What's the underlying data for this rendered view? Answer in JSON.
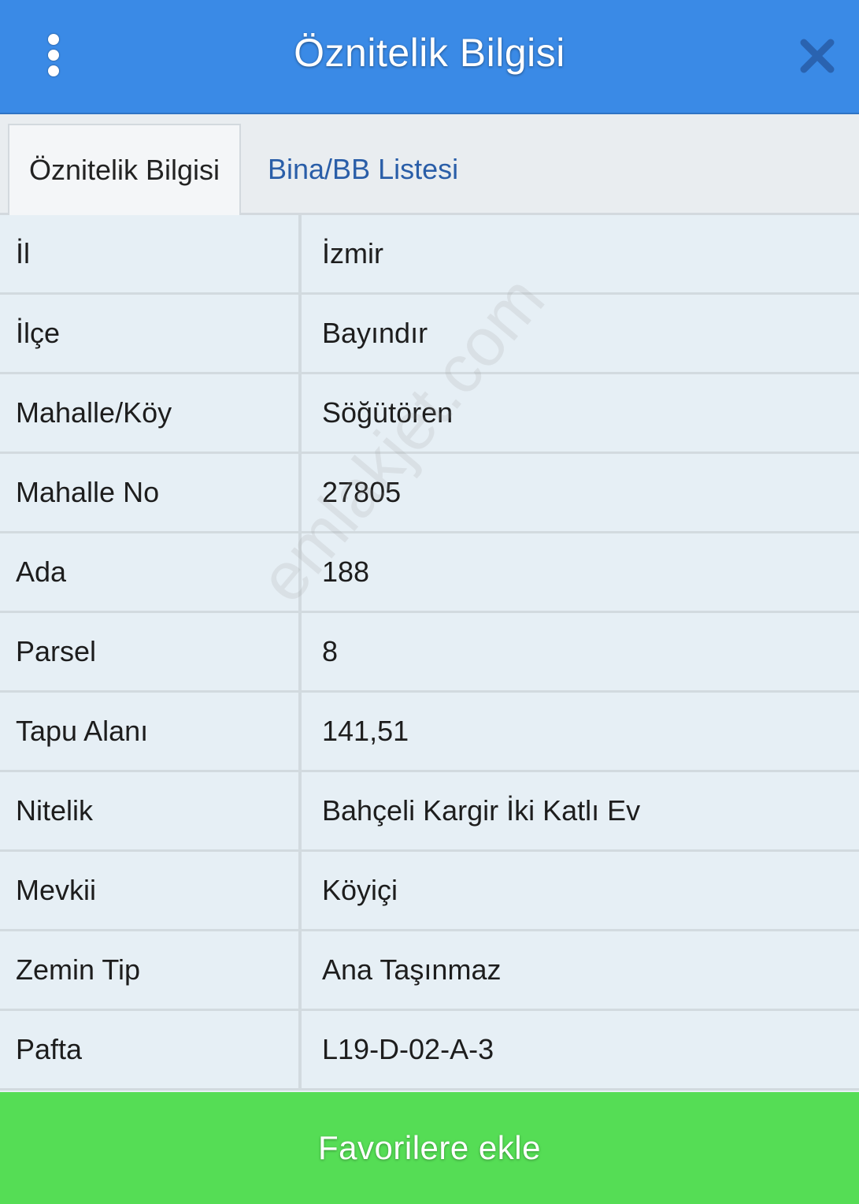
{
  "header": {
    "title": "Öznitelik Bilgisi",
    "menu_icon": "vertical-dots-icon",
    "close_icon": "close-icon"
  },
  "tabs": [
    {
      "label": "Öznitelik Bilgisi",
      "active": true
    },
    {
      "label": "Bina/BB Listesi",
      "active": false
    }
  ],
  "attributes": [
    {
      "label": "İl",
      "value": "İzmir"
    },
    {
      "label": "İlçe",
      "value": "Bayındır"
    },
    {
      "label": "Mahalle/Köy",
      "value": "Söğütören"
    },
    {
      "label": "Mahalle No",
      "value": "27805"
    },
    {
      "label": "Ada",
      "value": "188"
    },
    {
      "label": "Parsel",
      "value": "8"
    },
    {
      "label": "Tapu Alanı",
      "value": "141,51"
    },
    {
      "label": "Nitelik",
      "value": "Bahçeli Kargir İki Katlı Ev"
    },
    {
      "label": "Mevkii",
      "value": "Köyiçi"
    },
    {
      "label": "Zemin Tip",
      "value": "Ana Taşınmaz"
    },
    {
      "label": "Pafta",
      "value": "L19-D-02-A-3"
    }
  ],
  "watermark": "emlakjet.com",
  "footer": {
    "favorite_label": "Favorilere ekle"
  },
  "colors": {
    "header_bg": "#3a8ae6",
    "button_bg": "#55dd55",
    "inactive_tab_text": "#2a5ea8"
  }
}
